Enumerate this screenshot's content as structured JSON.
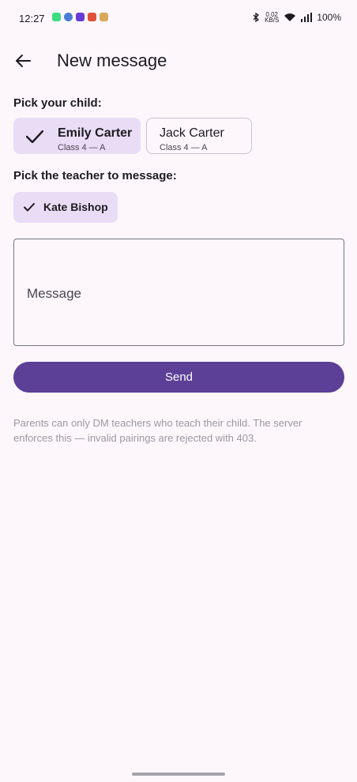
{
  "status_bar": {
    "time": "12:27",
    "net_speed_value": "0.02",
    "net_speed_unit": "KB/S",
    "battery": "100%"
  },
  "top_bar": {
    "title": "New message"
  },
  "child_section": {
    "label": "Pick your child:",
    "children": [
      {
        "name": "Emily Carter",
        "class": "Class 4 — A",
        "selected": true
      },
      {
        "name": "Jack Carter",
        "class": "Class 4 — A",
        "selected": false
      }
    ]
  },
  "teacher_section": {
    "label": "Pick the teacher to message:",
    "teachers": [
      {
        "name": "Kate Bishop",
        "selected": true
      }
    ]
  },
  "message_field": {
    "label": "Message",
    "value": ""
  },
  "send_button": {
    "label": "Send"
  },
  "note": "Parents can only DM teachers who teach their child. The server enforces this — invalid pairings are rejected with 403.",
  "colors": {
    "background": "#fdf7fc",
    "selected_chip": "#e9ddf6",
    "primary": "#5c3f97",
    "note_text": "#9c98a1"
  }
}
